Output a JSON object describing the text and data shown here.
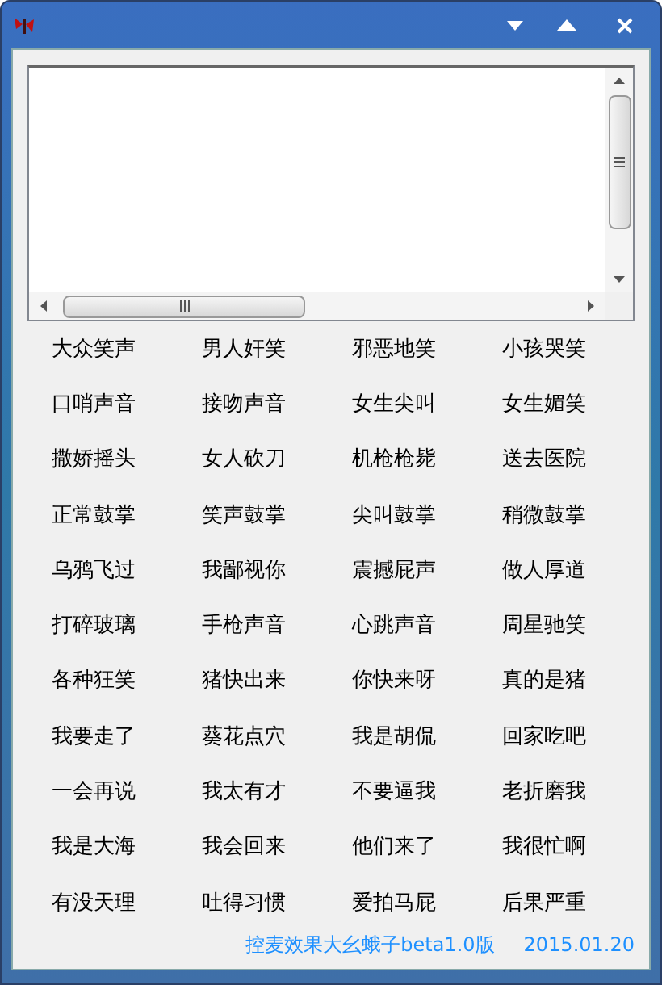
{
  "sound_buttons": [
    "大众笑声",
    "男人奸笑",
    "邪恶地笑",
    "小孩哭笑",
    "口哨声音",
    "接吻声音",
    "女生尖叫",
    "女生媚笑",
    "撒娇摇头",
    "女人砍刀",
    "机枪枪毙",
    "送去医院",
    "正常鼓掌",
    "笑声鼓掌",
    "尖叫鼓掌",
    "稍微鼓掌",
    "乌鸦飞过",
    "我鄙视你",
    "震撼屁声",
    "做人厚道",
    "打碎玻璃",
    "手枪声音",
    "心跳声音",
    "周星驰笑",
    "各种狂笑",
    "猪快出来",
    "你快来呀",
    "真的是猪",
    "我要走了",
    "葵花点穴",
    "我是胡侃",
    "回家吃吧",
    "一会再说",
    "我太有才",
    "不要逼我",
    "老折磨我",
    "我是大海",
    "我会回来",
    "他们来了",
    "我很忙啊",
    "有没天理",
    "吐得习惯",
    "爱拍马屁",
    "后果严重"
  ],
  "footer": {
    "title": "控麦效果大幺蛾子beta1.0版",
    "date": "2015.01.20"
  }
}
